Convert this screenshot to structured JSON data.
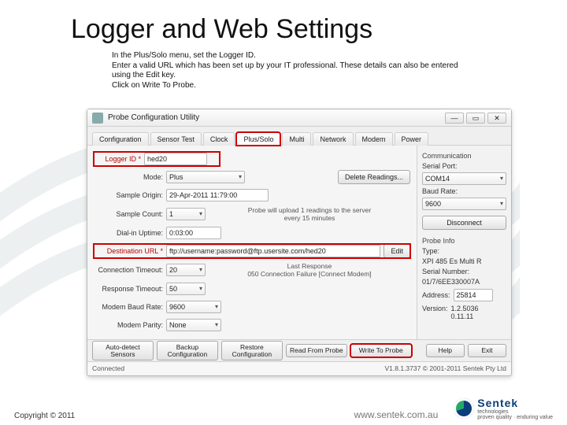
{
  "slide": {
    "title": "Logger and Web Settings",
    "instructions_l1": "In the Plus/Solo menu, set the Logger ID.",
    "instructions_l2": "Enter a valid URL which has been set up by your IT professional. These details can also be entered using the Edit key.",
    "instructions_l3": "Click on Write To Probe."
  },
  "window": {
    "title": "Probe Configuration Utility",
    "min": "—",
    "max": "▭",
    "close": "✕"
  },
  "tabs": [
    "Configuration",
    "Sensor Test",
    "Clock",
    "Plus/Solo",
    "Multi",
    "Network",
    "Modem",
    "Power"
  ],
  "form": {
    "logger_id_label": "Logger ID  *",
    "logger_id_value": "hed20",
    "mode_label": "Mode:",
    "mode_value": "Plus",
    "delete_readings": "Delete Readings...",
    "sample_origin_label": "Sample Origin:",
    "sample_origin_value": "29-Apr-2011 11:79:00",
    "sample_count_label": "Sample Count:",
    "sample_count_value": "1",
    "upload_msg1": "Probe will upload 1 readings to the server",
    "upload_msg2": "every 15 minutes",
    "dialin_label": "Dial-in Uptime:",
    "dialin_value": "0:03:00",
    "dest_url_label": "Destination URL  *",
    "dest_url_value": "ftp://username:password@ftp.usersite.com/hed20",
    "edit_btn": "Edit",
    "conn_timeout_label": "Connection Timeout:",
    "conn_timeout_value": "20",
    "last_response_label": "Last Response",
    "last_response_value": "050 Connection Failure [Connect Modem]",
    "resp_timeout_label": "Response Timeout:",
    "resp_timeout_value": "50",
    "baud_label": "Modem Baud Rate:",
    "baud_value": "9600",
    "parity_label": "Modem Parity:",
    "parity_value": "None"
  },
  "right": {
    "comm_title": "Communication",
    "serial_port_label": "Serial Port:",
    "serial_port_value": "COM14",
    "baud_label": "Baud Rate:",
    "baud_value": "9600",
    "disconnect": "Disconnect",
    "probe_info": "Probe Info",
    "type_label": "Type:",
    "type_value": "XPI 485 Es Multi R",
    "serial_label": "Serial Number:",
    "serial_value": "01/7/6EE330007A",
    "address_label": "Address:",
    "address_value": "25814",
    "version_label": "Version:",
    "version_value1": "1.2.5036",
    "version_value2": "0.11.11"
  },
  "buttons": {
    "auto_detect": "Auto-detect Sensors",
    "backup": "Backup Configuration",
    "restore": "Restore Configuration",
    "read": "Read From Probe",
    "write": "Write To Probe",
    "help": "Help",
    "exit": "Exit"
  },
  "status": {
    "left": "Connected",
    "right": "V1.8.1.3737 © 2001-2011 Sentek Pty Ltd"
  },
  "footer": {
    "copyright": "Copyright © 2011",
    "url": "www.sentek.com.au",
    "brand": "Sentek",
    "brand_sub": "technologies",
    "tagline": "proven quality · enduring value"
  }
}
